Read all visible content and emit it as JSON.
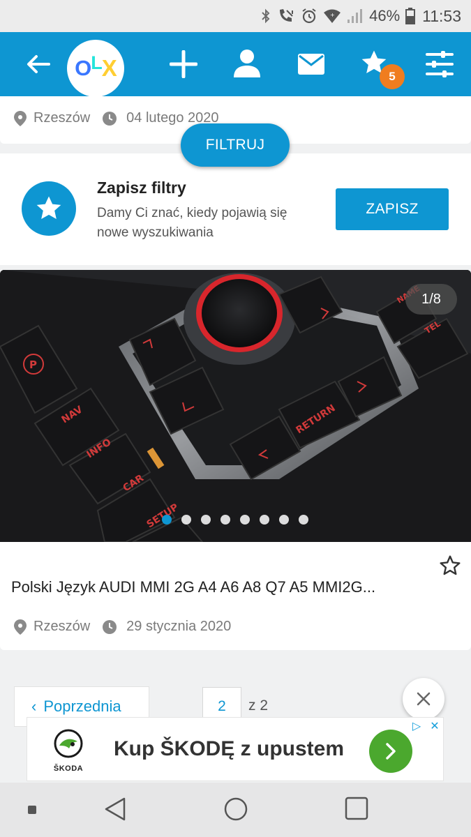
{
  "status_bar": {
    "battery_pct": "46%",
    "time": "11:53"
  },
  "app_bar": {
    "logo": {
      "o": "O",
      "l": "L",
      "x": "X"
    },
    "favorites_badge": "5",
    "icons": [
      "back-arrow-icon",
      "plus-icon",
      "user-icon",
      "mail-icon",
      "star-icon",
      "settings-sliders-icon"
    ]
  },
  "top_listing": {
    "location": "Rzeszów",
    "date": "04 lutego 2020"
  },
  "filter_button": "FILTRUJ",
  "save_filters": {
    "title": "Zapisz filtry",
    "description": "Damy Ci znać, kiedy pojawią się nowe wyszukiwania",
    "button": "ZAPISZ"
  },
  "listing": {
    "photo_counter": "1/8",
    "title": "Polski Język AUDI MMI 2G A4 A6 A8 Q7 A5 MMI2G...",
    "location": "Rzeszów",
    "date": "29 stycznia 2020",
    "photo_labels": {
      "nav": "NAV",
      "info": "INFO",
      "car": "CAR",
      "setup": "SETUP",
      "return": "RETURN",
      "tel": "TEL",
      "name": "NAME"
    }
  },
  "pagination": {
    "prev_label": "Poprzednia",
    "current_page": "2",
    "of_total": "z 2"
  },
  "ad": {
    "brand": "ŠKODA",
    "text": "Kup ŠKODĘ z upustem"
  },
  "colors": {
    "primary": "#0e96d2",
    "badge": "#f07d1f",
    "ad_green": "#4ba82e"
  }
}
